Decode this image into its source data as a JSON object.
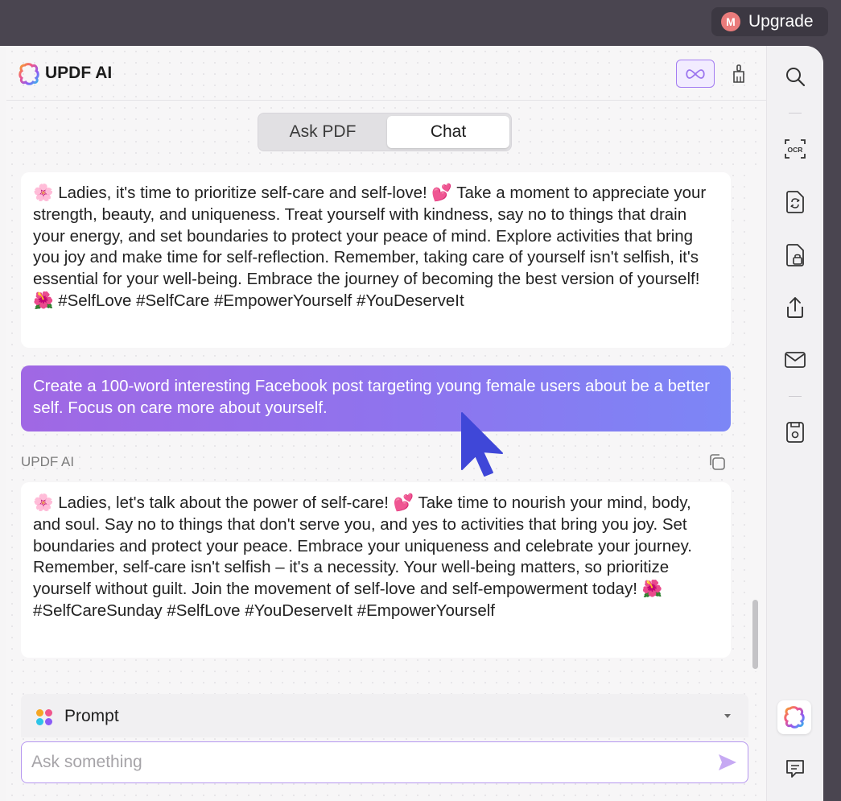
{
  "topbar": {
    "avatar_letter": "M",
    "upgrade_label": "Upgrade"
  },
  "header": {
    "title": "UPDF AI"
  },
  "tabs": [
    {
      "label": "Ask PDF",
      "active": false
    },
    {
      "label": "Chat",
      "active": true
    }
  ],
  "messages": {
    "first_reply": "🌸 Ladies, it's time to prioritize self-care and self-love! 💕 Take a moment to appreciate your strength, beauty, and uniqueness. Treat yourself with kindness, say no to things that drain your energy, and set boundaries to protect your peace of mind. Explore activities that bring you joy and make time for self-reflection. Remember, taking care of yourself isn't selfish, it's essential for your well-being. Embrace the journey of becoming the best version of yourself! 🌺 #SelfLove #SelfCare #EmpowerYourself #YouDeserveIt",
    "user_prompt": "Create a 100-word interesting Facebook post targeting young female users about be a better self. Focus on care more about yourself.",
    "ai_label": "UPDF AI",
    "second_reply": "🌸 Ladies, let's talk about the power of self-care! 💕 Take time to nourish your mind, body, and soul. Say no to things that don't serve you, and yes to activities that bring you joy. Set boundaries and protect your peace. Embrace your uniqueness and celebrate your journey. Remember, self-care isn't selfish – it's a necessity. Your well-being matters, so prioritize yourself without guilt. Join the movement of self-love and self-empowerment today! 🌺 #SelfCareSunday #SelfLove #YouDeserveIt #EmpowerYourself"
  },
  "prompt": {
    "label": "Prompt",
    "input_placeholder": "Ask something",
    "input_value": ""
  },
  "sidebar": {
    "icons": [
      "search-icon",
      "ocr-icon",
      "convert-icon",
      "protect-icon",
      "share-icon",
      "mail-icon",
      "save-icon",
      "updf-ai-icon",
      "comment-icon"
    ],
    "ocr_text": "OCR"
  },
  "colors": {
    "accent_purple": "#a37cf2",
    "user_bubble_start": "#a068e4",
    "user_bubble_end": "#7c86f6",
    "cursor_blue": "#3f47d8"
  }
}
